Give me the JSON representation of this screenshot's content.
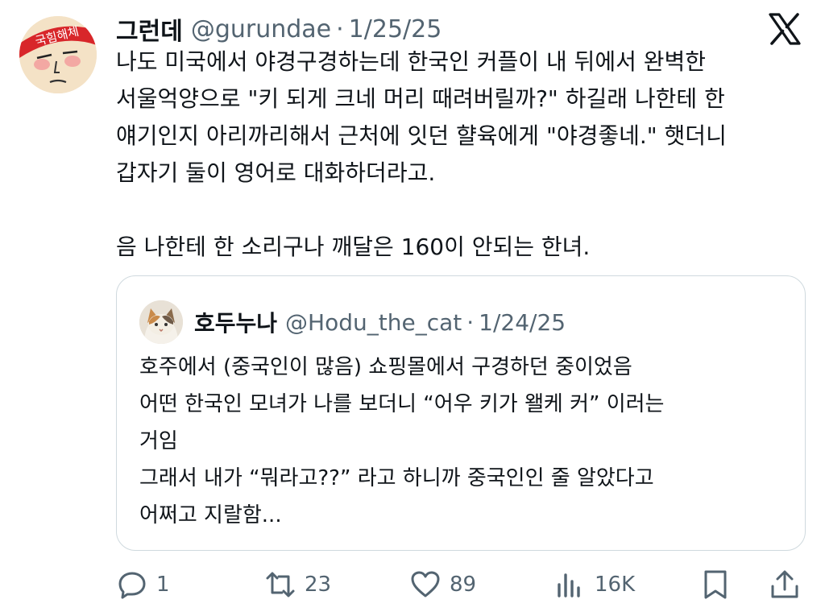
{
  "tweet": {
    "author_name": "그런데",
    "handle": "@gurundae",
    "separator": "·",
    "date": "1/25/25",
    "avatar_headband_text": "국힘해체",
    "lines": [
      "나도 미국에서 야경구경하는데 한국인 커플이 내 뒤에서 완벽한",
      "서울억양으로 \"키 되게 크네 머리 때려버릴까?\" 하길래 나한테 한",
      "얘기인지 아리까리해서 근처에 잇던 햘육에게 \"야경좋네.\" 햇더니",
      "갑자기 둘이 영어로 대화하더라고.",
      "",
      "음 나한테 한 소리구나 깨달은 160이 안되는 한녀."
    ]
  },
  "quoted": {
    "author_name": "호두누나",
    "handle": "@Hodu_the_cat",
    "separator": "·",
    "date": "1/24/25",
    "lines": [
      "호주에서 (중국인이 많음) 쇼핑몰에서 구경하던 중이었음",
      "어떤 한국인 모녀가 나를 보더니 “어우 키가 왤케 커” 이러는",
      "거임",
      "그래서 내가 “뭐라고??” 라고 하니까 중국인인 줄 알았다고",
      "어쩌고 지랄함..."
    ]
  },
  "actions": {
    "reply_count": "1",
    "retweet_count": "23",
    "like_count": "89",
    "views_count": "16K"
  },
  "icons": {
    "logo": "x-logo-icon",
    "reply": "reply-icon",
    "retweet": "retweet-icon",
    "like": "heart-icon",
    "views": "views-icon",
    "bookmark": "bookmark-icon",
    "share": "share-icon"
  },
  "colors": {
    "text": "#0f1419",
    "secondary": "#536471",
    "border": "#cfd9de",
    "headband": "#d8262a"
  }
}
